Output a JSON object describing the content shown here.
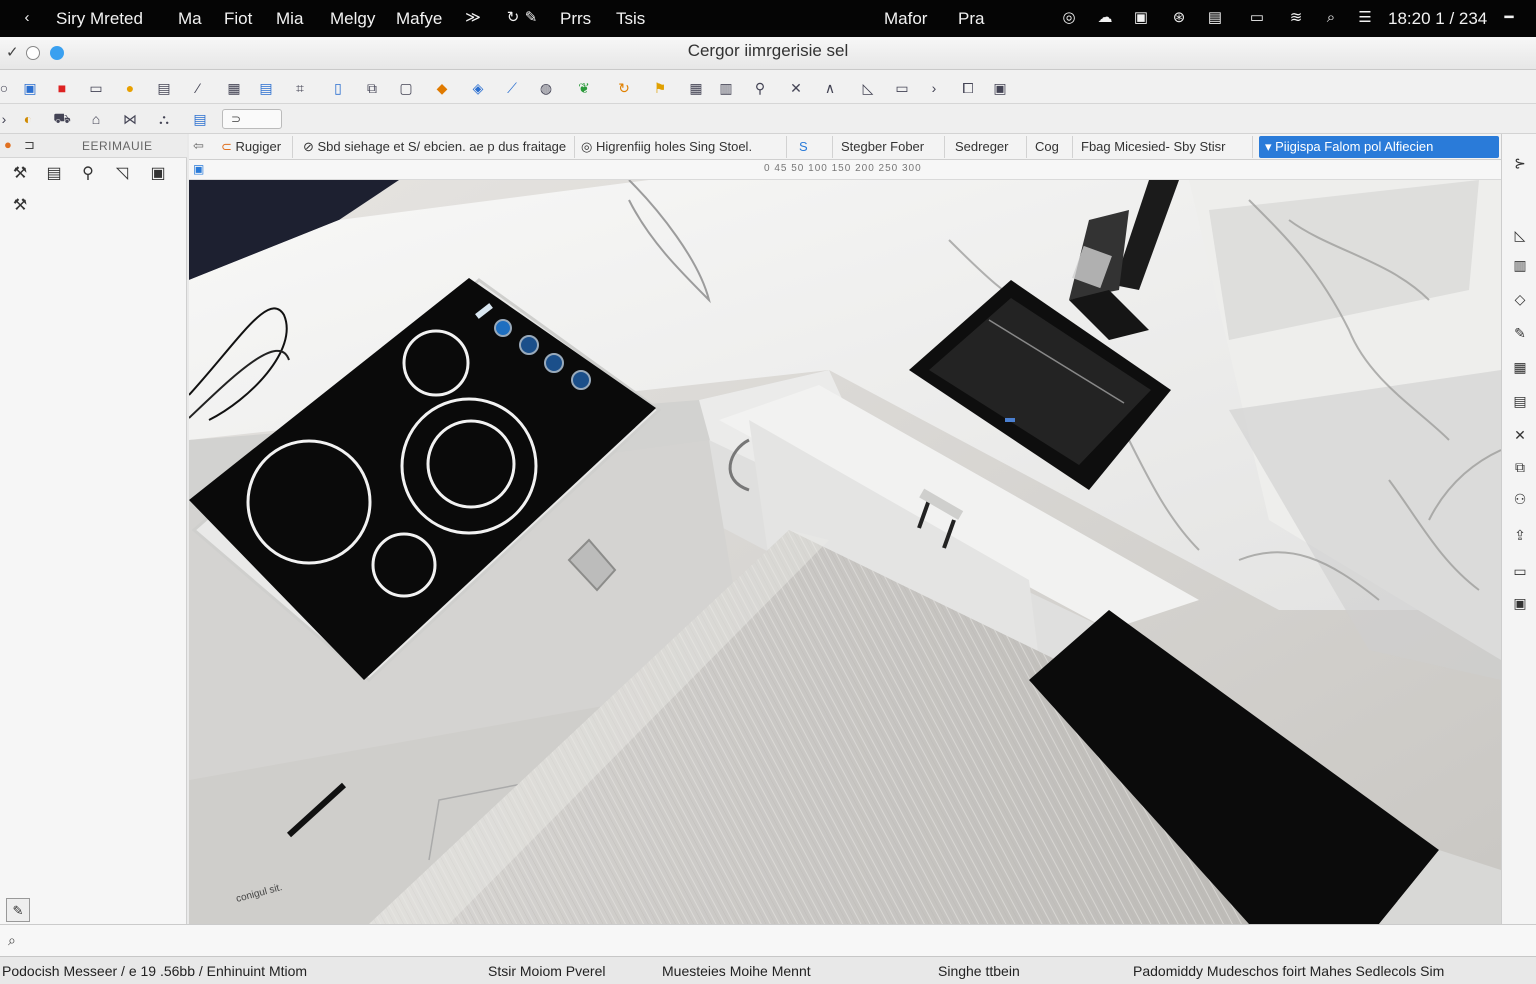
{
  "menubar": {
    "app_name": "Siry Mreted",
    "items": [
      "Ma",
      "Fiot",
      "Mia",
      "Melgy",
      "Mafye",
      "Prrs",
      "Tsis"
    ],
    "right_items": [
      "Mafor",
      "Pra"
    ],
    "clock": "18:20 1 / 234"
  },
  "window": {
    "title": "Cergor iimrgerisie sel"
  },
  "left_panel": {
    "header": "EERIMAUIE"
  },
  "tabs": [
    {
      "label": "Rugiger"
    },
    {
      "label": "Sbd siehage et S/ ebcien. ae p dus fraitage"
    },
    {
      "label": "Higrenfiig holes Sing Stoel."
    },
    {
      "label": "S"
    },
    {
      "label": "Stegber Fober"
    },
    {
      "label": "Sedreger"
    },
    {
      "label": "Cog"
    },
    {
      "label": "Fbag Micesied- Sby Stisr"
    },
    {
      "label": "Piigispa Falom pol Alfiecien"
    }
  ],
  "ruler": {
    "text": "0 45 50 100 150 200 250 300"
  },
  "canvas": {
    "annotation": "conigul sit."
  },
  "status": {
    "left": "Podocish Messeer / e 19 .56bb / Enhinuint Mtiom",
    "center_a": "Stsir Moiom Pverel",
    "center_b": "Muesteies Moihe Mennt",
    "center_c": "Singhe ttbein",
    "right": "Padomiddy Mudeschos foirt Mahes Sedlecols Sim"
  },
  "colors": {
    "accent": "#2a7bd9",
    "menubar": "#050505",
    "cooktop": "#0a0a0a"
  }
}
